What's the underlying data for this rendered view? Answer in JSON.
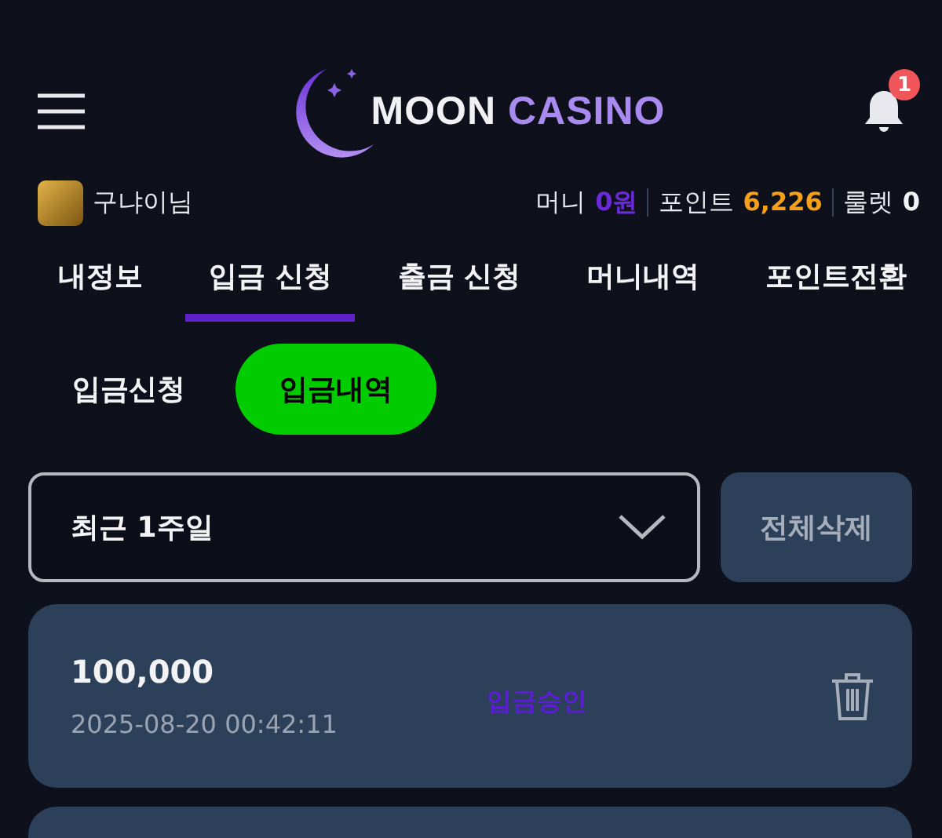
{
  "header": {
    "logo": {
      "word_1": "MOON",
      "word_2": "CASINO"
    },
    "notification_count": "1"
  },
  "user": {
    "name": "구냐이님",
    "stats": [
      {
        "kind": "money",
        "label": "머니",
        "value": "0원"
      },
      {
        "kind": "points",
        "label": "포인트",
        "value": "6,226"
      },
      {
        "kind": "roulette",
        "label": "룰렛",
        "value": "0"
      }
    ]
  },
  "tabs": [
    {
      "label": "내정보",
      "selected": false
    },
    {
      "label": "입금 신청",
      "selected": true
    },
    {
      "label": "출금 신청",
      "selected": false
    },
    {
      "label": "머니내역",
      "selected": false
    },
    {
      "label": "포인트전환",
      "selected": false
    }
  ],
  "sub_tabs": [
    {
      "label": "입금신청",
      "selected": false
    },
    {
      "label": "입금내역",
      "selected": true
    }
  ],
  "filter": {
    "period": "최근 1주일",
    "delete_all": "전체삭제"
  },
  "records": [
    {
      "amount": "100,000",
      "time": "2025-08-20 00:42:11",
      "status": "입금승인"
    }
  ]
}
